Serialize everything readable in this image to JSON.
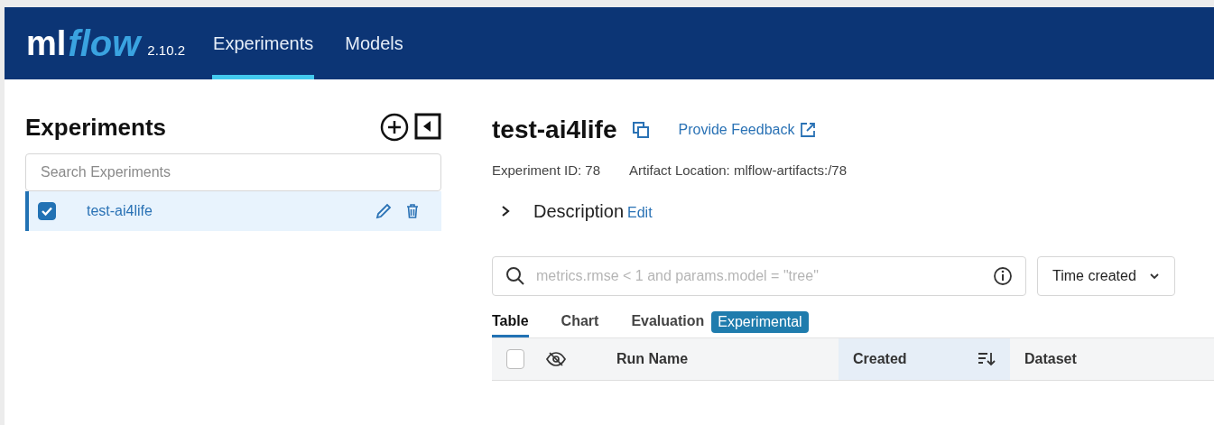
{
  "header": {
    "logo": {
      "part_1": "ml",
      "part_2": "flow"
    },
    "version": "2.10.2",
    "nav": [
      {
        "label": "Experiments",
        "selected": true
      },
      {
        "label": "Models",
        "selected": false
      }
    ]
  },
  "sidebar": {
    "title": "Experiments",
    "search": {
      "placeholder": "Search Experiments"
    },
    "items": [
      {
        "name": "test-ai4life",
        "checked": true,
        "selected": true
      }
    ]
  },
  "experiment": {
    "title": "test-ai4life",
    "feedback_link": "Provide Feedback",
    "experiment_id": "Experiment ID: 78",
    "artifact_location": "Artifact Location: mlflow-artifacts:/78",
    "description": {
      "label": "Description",
      "edit": "Edit",
      "expanded": false
    },
    "run_search": {
      "placeholder": "metrics.rmse < 1 and params.model = \"tree\""
    },
    "sort": {
      "value": "Time created"
    },
    "tabs": [
      {
        "label": "Table",
        "selected": true
      },
      {
        "label": "Chart",
        "selected": false
      },
      {
        "label": "Evaluation",
        "selected": false
      }
    ],
    "badge": "Experimental",
    "table": {
      "columns": [
        {
          "label": "Run Name",
          "sorted": false
        },
        {
          "label": "Created",
          "sorted": true
        },
        {
          "label": "Dataset",
          "sorted": false
        }
      ],
      "all_checked": false
    }
  }
}
